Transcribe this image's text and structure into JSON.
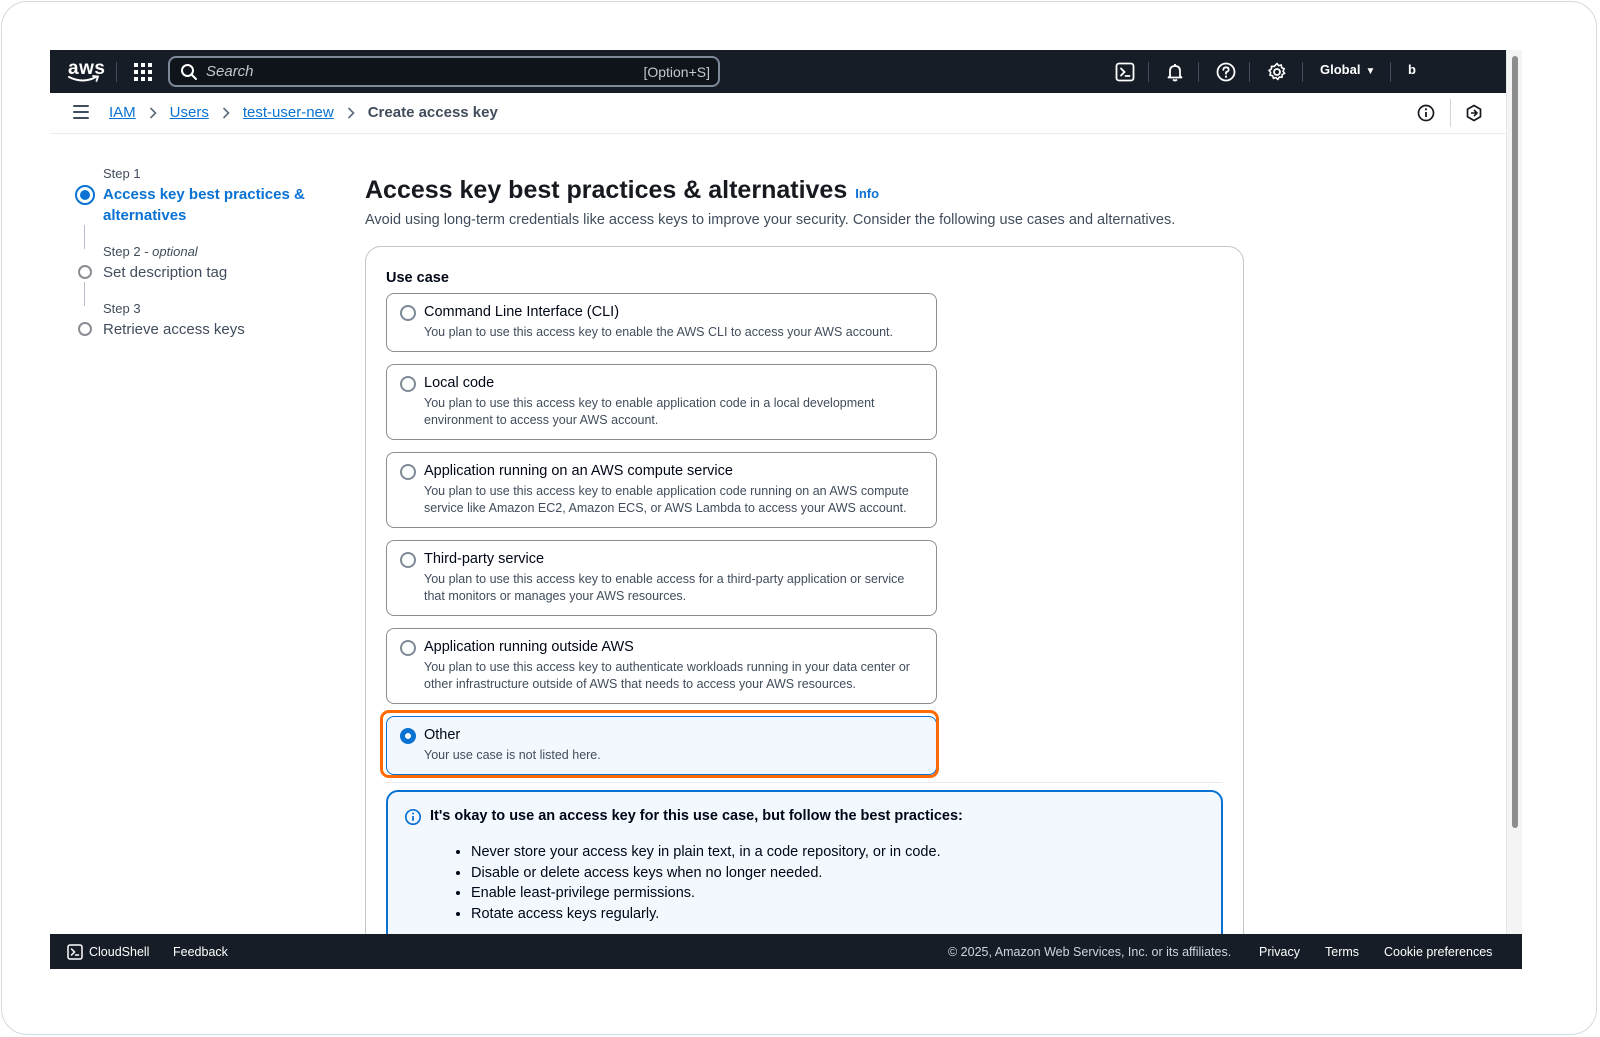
{
  "topnav": {
    "logo_text": "aws",
    "search_placeholder": "Search",
    "search_shortcut": "[Option+S]",
    "region": "Global",
    "user": "b"
  },
  "breadcrumb": {
    "items": [
      "IAM",
      "Users",
      "test-user-new"
    ],
    "current": "Create access key"
  },
  "steps": [
    {
      "label": "Step 1",
      "title": "Access key best practices & alternatives",
      "state": "active"
    },
    {
      "label": "Step 2",
      "optional": "optional",
      "title": "Set description tag",
      "state": "pending"
    },
    {
      "label": "Step 3",
      "title": "Retrieve access keys",
      "state": "pending"
    }
  ],
  "main": {
    "title": "Access key best practices & alternatives",
    "info": "Info",
    "description": "Avoid using long-term credentials like access keys to improve your security. Consider the following use cases and alternatives.",
    "use_case_label": "Use case",
    "options": [
      {
        "title": "Command Line Interface (CLI)",
        "desc": "You plan to use this access key to enable the AWS CLI to access your AWS account.",
        "selected": false
      },
      {
        "title": "Local code",
        "desc": "You plan to use this access key to enable application code in a local development environment to access your AWS account.",
        "selected": false
      },
      {
        "title": "Application running on an AWS compute service",
        "desc": "You plan to use this access key to enable application code running on an AWS compute service like Amazon EC2, Amazon ECS, or AWS Lambda to access your AWS account.",
        "selected": false
      },
      {
        "title": "Third-party service",
        "desc": "You plan to use this access key to enable access for a third-party application or service that monitors or manages your AWS resources.",
        "selected": false
      },
      {
        "title": "Application running outside AWS",
        "desc": "You plan to use this access key to authenticate workloads running in your data center or other infrastructure outside of AWS that needs to access your AWS resources.",
        "selected": false
      },
      {
        "title": "Other",
        "desc": "Your use case is not listed here.",
        "selected": true
      }
    ],
    "alert": {
      "title": "It's okay to use an access key for this use case, but follow the best practices:",
      "items": [
        "Never store your access key in plain text, in a code repository, or in code.",
        "Disable or delete access keys when no longer needed.",
        "Enable least-privilege permissions.",
        "Rotate access keys regularly."
      ]
    }
  },
  "footer": {
    "cloudshell": "CloudShell",
    "feedback": "Feedback",
    "copyright": "© 2025, Amazon Web Services, Inc. or its affiliates.",
    "privacy": "Privacy",
    "terms": "Terms",
    "cookies": "Cookie preferences"
  },
  "colors": {
    "nav_bg": "#161d26",
    "link_blue": "#0972d3",
    "highlight_orange": "#ff6a00",
    "alert_bg": "#f2f8fd"
  }
}
